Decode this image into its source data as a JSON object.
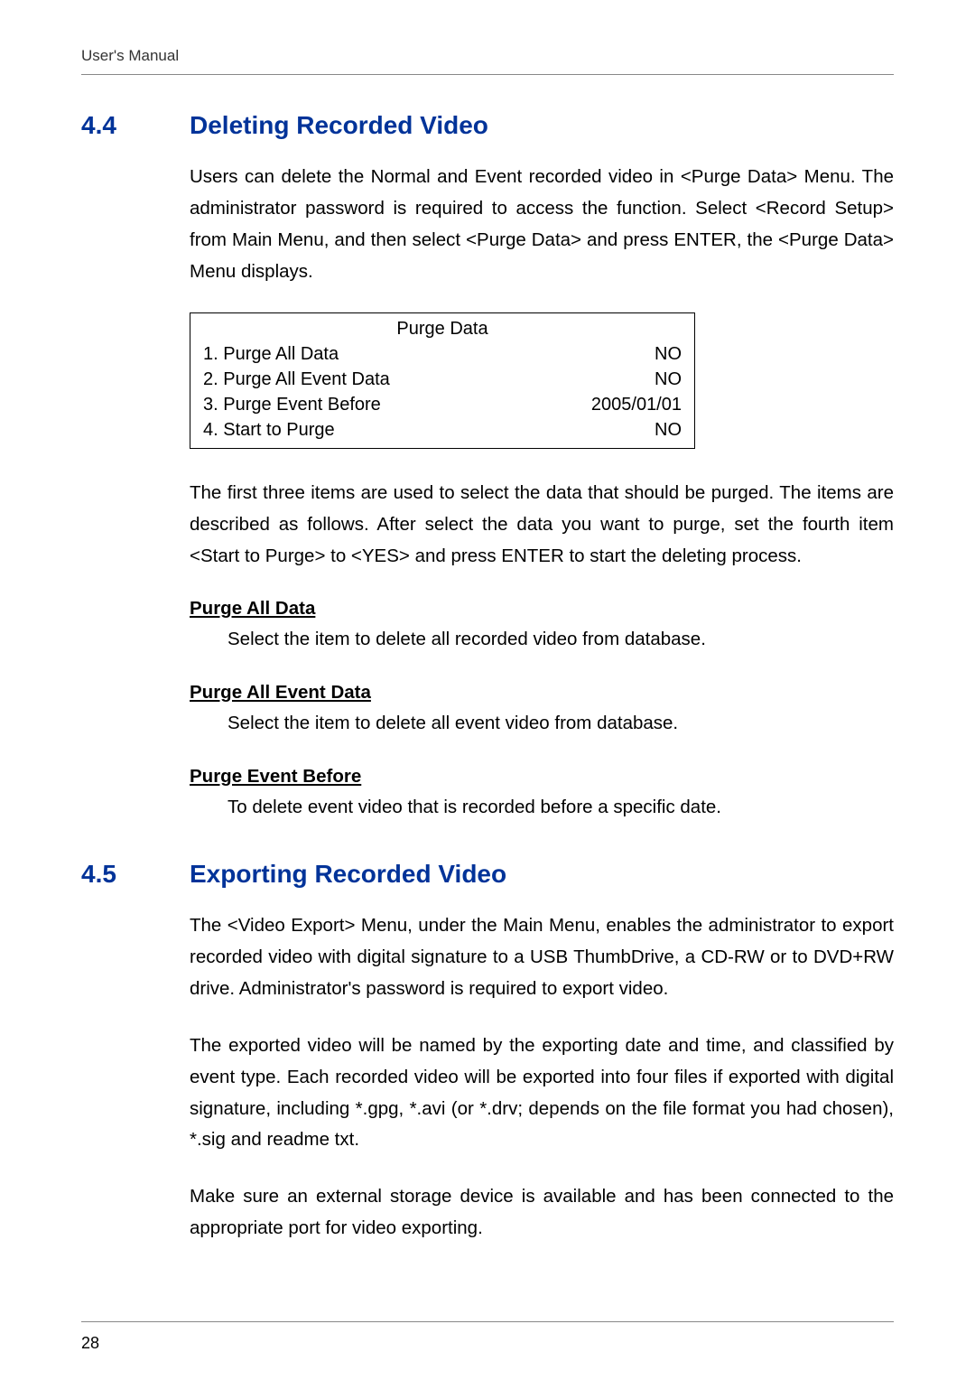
{
  "header": "User's Manual",
  "section44": {
    "number": "4.4",
    "title": "Deleting Recorded Video",
    "para1": "Users can delete the Normal and Event recorded video in <Purge Data> Menu. The administrator password is required to access the function. Select <Record Setup> from Main Menu, and then select <Purge Data> and press ENTER, the <Purge Data> Menu displays.",
    "menu": {
      "title": "Purge Data",
      "rows": [
        {
          "label": "1. Purge All Data",
          "value": "NO"
        },
        {
          "label": "2. Purge All Event Data",
          "value": "NO"
        },
        {
          "label": "3. Purge Event Before",
          "value": "2005/01/01"
        },
        {
          "label": "4. Start to Purge",
          "value": "NO"
        }
      ]
    },
    "para2": "The first three items are used to select the data that should be purged. The items are described as follows. After select the data you want to purge, set the fourth item <Start to Purge> to <YES> and press ENTER to start the deleting process.",
    "sub1": {
      "heading": "Purge All Data",
      "text": "Select the item to delete all recorded video from database."
    },
    "sub2": {
      "heading": "Purge All Event Data",
      "text": "Select the item to delete all event video from database."
    },
    "sub3": {
      "heading": "Purge Event Before",
      "text": "To delete event video that is recorded before a specific date."
    }
  },
  "section45": {
    "number": "4.5",
    "title": "Exporting Recorded Video",
    "para1": "The <Video Export> Menu, under the Main Menu, enables the administrator to export recorded video with digital signature to a USB ThumbDrive, a CD-RW or to DVD+RW drive. Administrator's password is required to export video.",
    "para2": "The exported video will be named by the exporting date and time, and classified by event type. Each recorded video will be exported into four files if exported with digital signature, including *.gpg, *.avi (or *.drv; depends on the file format you had chosen), *.sig and readme txt.",
    "para3": "Make sure an external storage device is available and has been connected to the appropriate port for video exporting."
  },
  "pageNumber": "28"
}
